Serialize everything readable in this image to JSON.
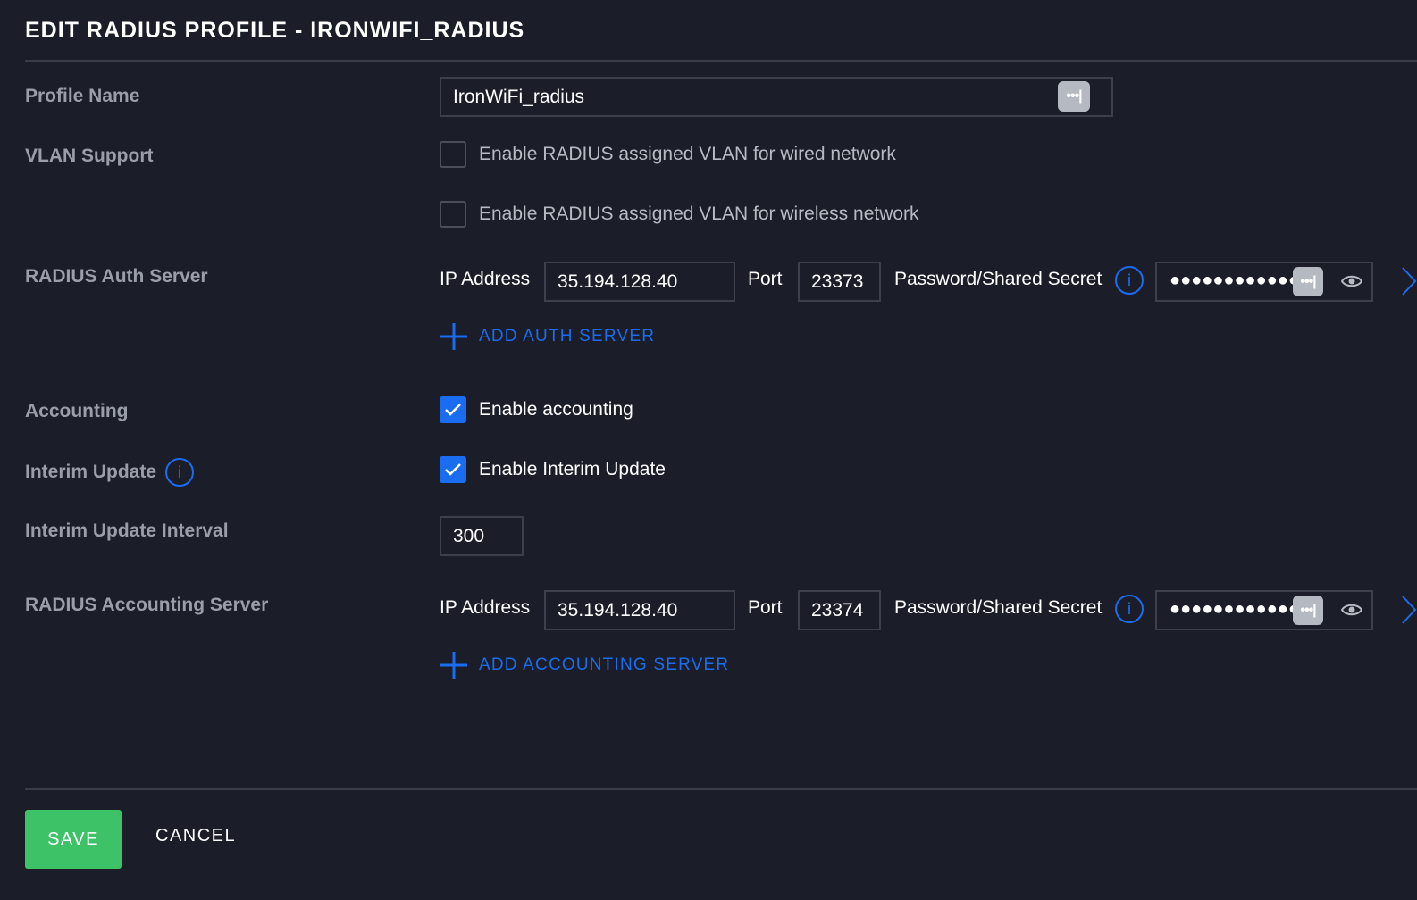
{
  "title": "EDIT RADIUS PROFILE - IRONWIFI_RADIUS",
  "profile_name": {
    "label": "Profile Name",
    "value": "IronWiFi_radius"
  },
  "vlan_support": {
    "label": "VLAN Support",
    "wired_label": "Enable RADIUS assigned VLAN for wired network",
    "wireless_label": "Enable RADIUS assigned VLAN for wireless network",
    "wired_checked": false,
    "wireless_checked": false
  },
  "auth_server": {
    "label": "RADIUS Auth Server",
    "ip_label": "IP Address",
    "ip": "35.194.128.40",
    "port_label": "Port",
    "port": "23373",
    "secret_label": "Password/Shared Secret",
    "secret_masked": "●●●●●●●●●●●●●",
    "add_label": "ADD AUTH SERVER"
  },
  "accounting": {
    "label": "Accounting",
    "checkbox_label": "Enable accounting",
    "checked": true
  },
  "interim_update": {
    "label": "Interim Update",
    "checkbox_label": "Enable Interim Update",
    "checked": true
  },
  "interim_interval": {
    "label": "Interim Update Interval",
    "value": "300"
  },
  "accounting_server": {
    "label": "RADIUS Accounting Server",
    "ip_label": "IP Address",
    "ip": "35.194.128.40",
    "port_label": "Port",
    "port": "23374",
    "secret_label": "Password/Shared Secret",
    "secret_masked": "●●●●●●●●●●●●●",
    "add_label": "ADD ACCOUNTING SERVER"
  },
  "actions": {
    "save": "SAVE",
    "cancel": "CANCEL"
  },
  "colors": {
    "background": "#1b1e29",
    "accent": "#1a6cf0",
    "save": "#3ec268"
  }
}
